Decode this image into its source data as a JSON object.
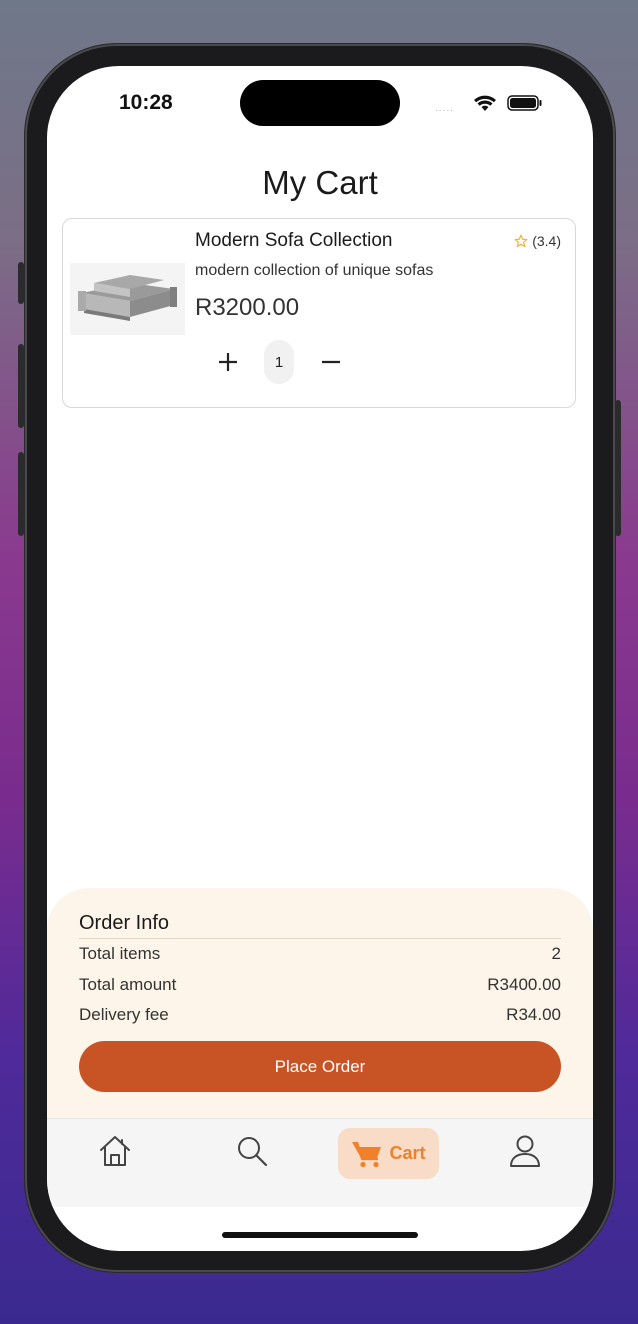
{
  "status_bar": {
    "time": "10:28",
    "signal": "....."
  },
  "page": {
    "title": "My Cart"
  },
  "cart_items": [
    {
      "name": "Modern Sofa Collection",
      "description": "modern collection of unique sofas",
      "price": "R3200.00",
      "rating": "(3.4)",
      "quantity": "1"
    }
  ],
  "order_info": {
    "title": "Order Info",
    "rows": [
      {
        "label": "Total items",
        "value": "2"
      },
      {
        "label": "Total amount",
        "value": "R3400.00"
      },
      {
        "label": "Delivery fee",
        "value": "R34.00"
      }
    ],
    "button_label": "Place Order"
  },
  "tabbar": {
    "items": [
      {
        "icon": "home-icon"
      },
      {
        "icon": "search-icon"
      },
      {
        "icon": "cart-icon",
        "label": "Cart",
        "active": true
      },
      {
        "icon": "user-icon"
      }
    ]
  },
  "colors": {
    "accent": "#c85426",
    "active_tab_bg": "#f8dcc7",
    "active_tab_fg": "#f0802a",
    "panel_bg": "#fdf5e9",
    "star": "#f2b233"
  }
}
